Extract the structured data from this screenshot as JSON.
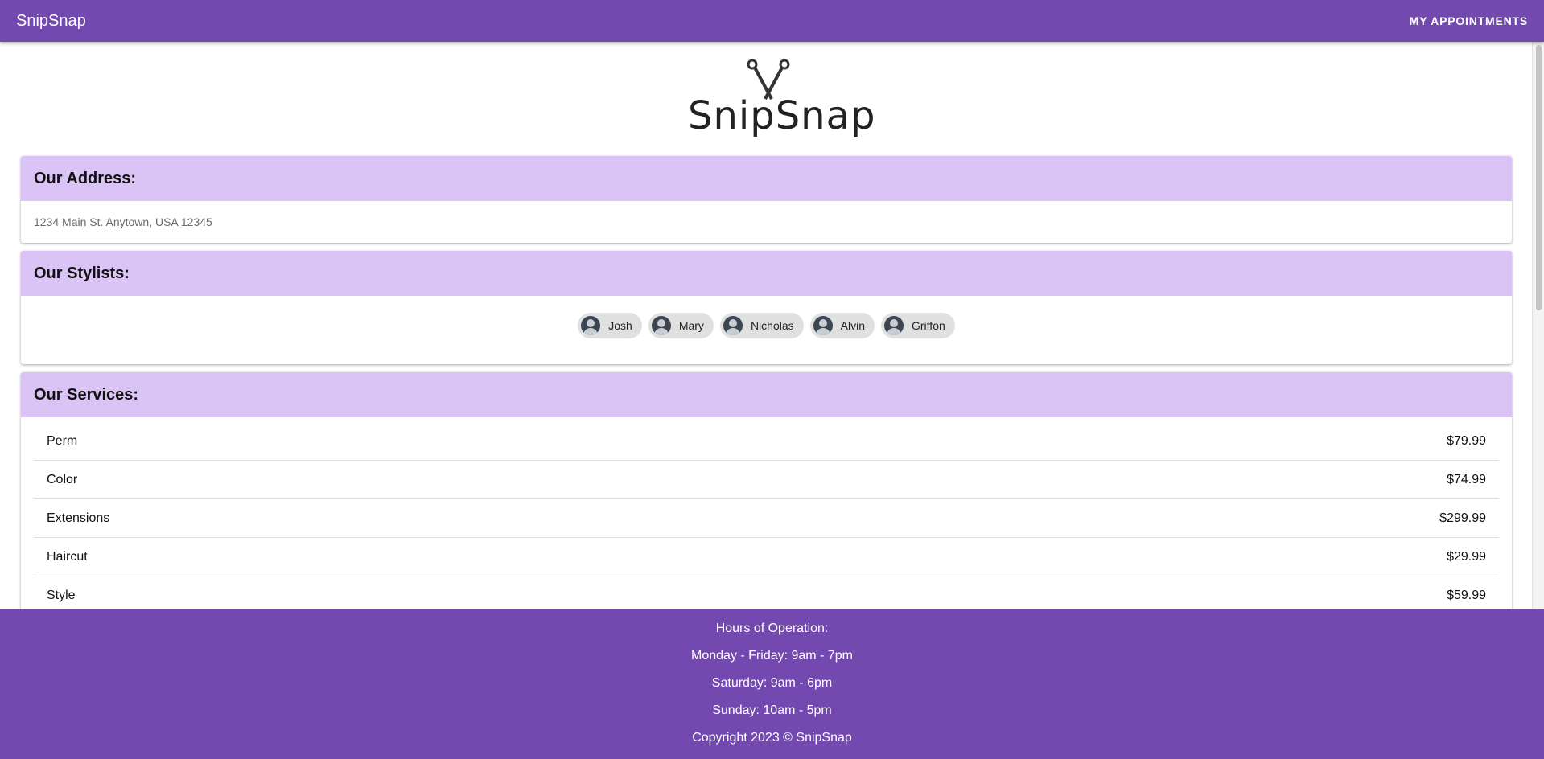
{
  "appbar": {
    "brand": "SnipSnap",
    "nav_label": "MY APPOINTMENTS"
  },
  "logo": {
    "text": "SnipSnap",
    "icon": "scissors-comb-icon"
  },
  "address": {
    "title": "Our Address:",
    "text": "1234 Main St. Anytown, USA 12345"
  },
  "stylists": {
    "title": "Our Stylists:",
    "items": [
      {
        "name": "Josh",
        "icon": "person-avatar-icon"
      },
      {
        "name": "Mary",
        "icon": "person-avatar-icon"
      },
      {
        "name": "Nicholas",
        "icon": "person-avatar-icon"
      },
      {
        "name": "Alvin",
        "icon": "person-avatar-icon"
      },
      {
        "name": "Griffon",
        "icon": "person-avatar-icon"
      }
    ]
  },
  "services": {
    "title": "Our Services:",
    "items": [
      {
        "name": "Perm",
        "price": "$79.99"
      },
      {
        "name": "Color",
        "price": "$74.99"
      },
      {
        "name": "Extensions",
        "price": "$299.99"
      },
      {
        "name": "Haircut",
        "price": "$29.99"
      },
      {
        "name": "Style",
        "price": "$59.99"
      }
    ]
  },
  "footer": {
    "hours_title": "Hours of Operation:",
    "weekday": "Monday - Friday: 9am - 7pm",
    "saturday": "Saturday: 9am - 6pm",
    "sunday": "Sunday: 10am - 5pm",
    "copyright": "Copyright 2023 © SnipSnap"
  },
  "colors": {
    "primary": "#7349b0",
    "card_header": "#dac3f5",
    "chip": "#e0e0e0"
  }
}
